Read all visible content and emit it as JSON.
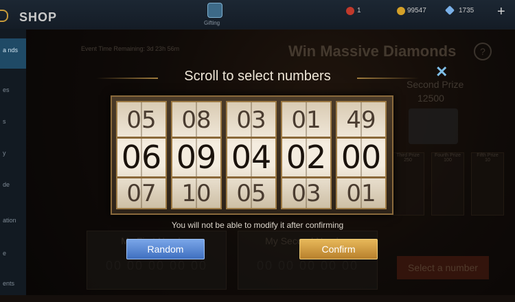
{
  "header": {
    "title": "SHOP",
    "gift_label": "Gifting",
    "tickets": "1",
    "battle_points": "99547",
    "diamonds": "1735",
    "plus": "+"
  },
  "sidebar": {
    "items": [
      {
        "label": "a\nnds"
      },
      {
        "label": "es"
      },
      {
        "label": "s"
      },
      {
        "label": "y"
      },
      {
        "label": "de"
      },
      {
        "label": "ation"
      },
      {
        "label": "e"
      },
      {
        "label": "ents"
      }
    ]
  },
  "background": {
    "event_time": "Event Time Remaining: 3d 23h 56m",
    "win_title": "Win Massive Diamonds",
    "help": "?",
    "second_prize_label": "Second Prize",
    "second_prize_value": "12500",
    "prize_cards": [
      {
        "label": "Third Prize",
        "value": "250"
      },
      {
        "label": "Fourth Prize",
        "value": "100"
      },
      {
        "label": "Fifth Prize",
        "value": "10"
      }
    ],
    "select_number": "Select a number",
    "tickets": [
      {
        "label": "My First Number",
        "digits": "00 00 00 00 00"
      },
      {
        "label": "My Second Number",
        "digits": "00 00 00 00 00"
      }
    ]
  },
  "modal": {
    "title": "Scroll to select numbers",
    "close": "✕",
    "reels": [
      {
        "above": "05",
        "selected": "06",
        "below": "07"
      },
      {
        "above": "08",
        "selected": "09",
        "below": "10"
      },
      {
        "above": "03",
        "selected": "04",
        "below": "05"
      },
      {
        "above": "01",
        "selected": "02",
        "below": "03"
      },
      {
        "above": "49",
        "selected": "00",
        "below": "01"
      }
    ],
    "warning": "You will not be able to modify it after confirming",
    "random_label": "Random",
    "confirm_label": "Confirm"
  },
  "colors": {
    "accent_gold": "#b8802c",
    "accent_blue": "#3f6fc0",
    "close_blue": "#7fbfe8"
  }
}
